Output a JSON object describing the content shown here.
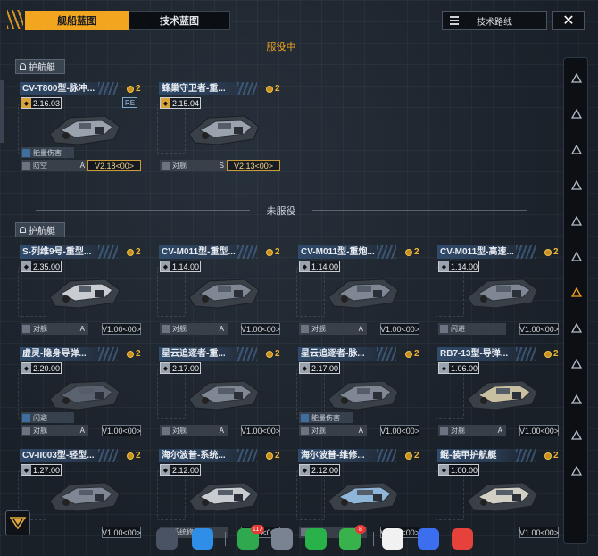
{
  "tabs": {
    "ship_blueprint": "舰船蓝图",
    "tech_blueprint": "技术蓝图"
  },
  "tech_route_label": "技术路线",
  "close_label": "✕",
  "sections": {
    "active": "服役中",
    "inactive": "未服役"
  },
  "category_label": "护航艇",
  "active_cards": [
    {
      "name": "CV-T800型-脉冲...",
      "count": "2",
      "version": "2.16.03",
      "re": "RE",
      "feature": "能量伤害",
      "role": "防空",
      "cls": "A",
      "vcode": "V2.18<00>",
      "gold": true
    },
    {
      "name": "蜂巢守卫者-重...",
      "count": "2",
      "version": "2.15.04",
      "role": "对舰",
      "cls": "S",
      "vcode": "V2.13<00>",
      "gold": true
    }
  ],
  "inactive_cards": [
    {
      "name": "S-列维9号-重型...",
      "count": "2",
      "version": "2.35.00",
      "role": "对舰",
      "cls": "A",
      "vcode": "V1.00<00>"
    },
    {
      "name": "CV-M011型-重型...",
      "count": "2",
      "version": "1.14.00",
      "role": "对舰",
      "cls": "A",
      "vcode": "V1.00<00>"
    },
    {
      "name": "CV-M011型-重炮...",
      "count": "2",
      "version": "1.14.00",
      "role": "对舰",
      "cls": "A",
      "vcode": "V1.00<00>"
    },
    {
      "name": "CV-M011型-高速...",
      "count": "2",
      "version": "1.14.00",
      "role": "闪避",
      "cls": "",
      "vcode": "V1.00<00>"
    },
    {
      "name": "虚灵-隐身导弹...",
      "count": "2",
      "version": "2.20.00",
      "feature": "闪避",
      "role": "对舰",
      "cls": "A",
      "vcode": "V1.00<00>"
    },
    {
      "name": "星云追逐者-重...",
      "count": "2",
      "version": "2.17.00",
      "role": "对舰",
      "cls": "A",
      "vcode": "V1.00<00>"
    },
    {
      "name": "星云追逐者-脉...",
      "count": "2",
      "version": "2.17.00",
      "feature": "能量伤害",
      "role": "对舰",
      "cls": "A",
      "vcode": "V1.00<00>"
    },
    {
      "name": "RB7-13型-导弹...",
      "count": "2",
      "version": "1.06.00",
      "role": "对舰",
      "cls": "A",
      "vcode": "V1.00<00>"
    },
    {
      "name": "CV-II003型-轻型...",
      "count": "2",
      "version": "1.27.00",
      "role": "",
      "cls": "",
      "vcode": "V1.00<00>"
    },
    {
      "name": "海尔波普-系统...",
      "count": "2",
      "version": "2.12.00",
      "role": "系统修复",
      "cls": "",
      "vcode": "V1.00<00>"
    },
    {
      "name": "海尔波普-维修...",
      "count": "2",
      "version": "2.12.00",
      "role": "维修",
      "cls": "",
      "vcode": "V1.00<00>"
    },
    {
      "name": "鲲-装甲护航艇",
      "count": "2",
      "version": "1.00.00",
      "role": "",
      "cls": "",
      "vcode": "V1.00<00>"
    }
  ],
  "dock_badges": {
    "messages": "117",
    "phone": "8"
  },
  "colors": {
    "accent": "#f2a51e",
    "panel": "#1c232c"
  }
}
